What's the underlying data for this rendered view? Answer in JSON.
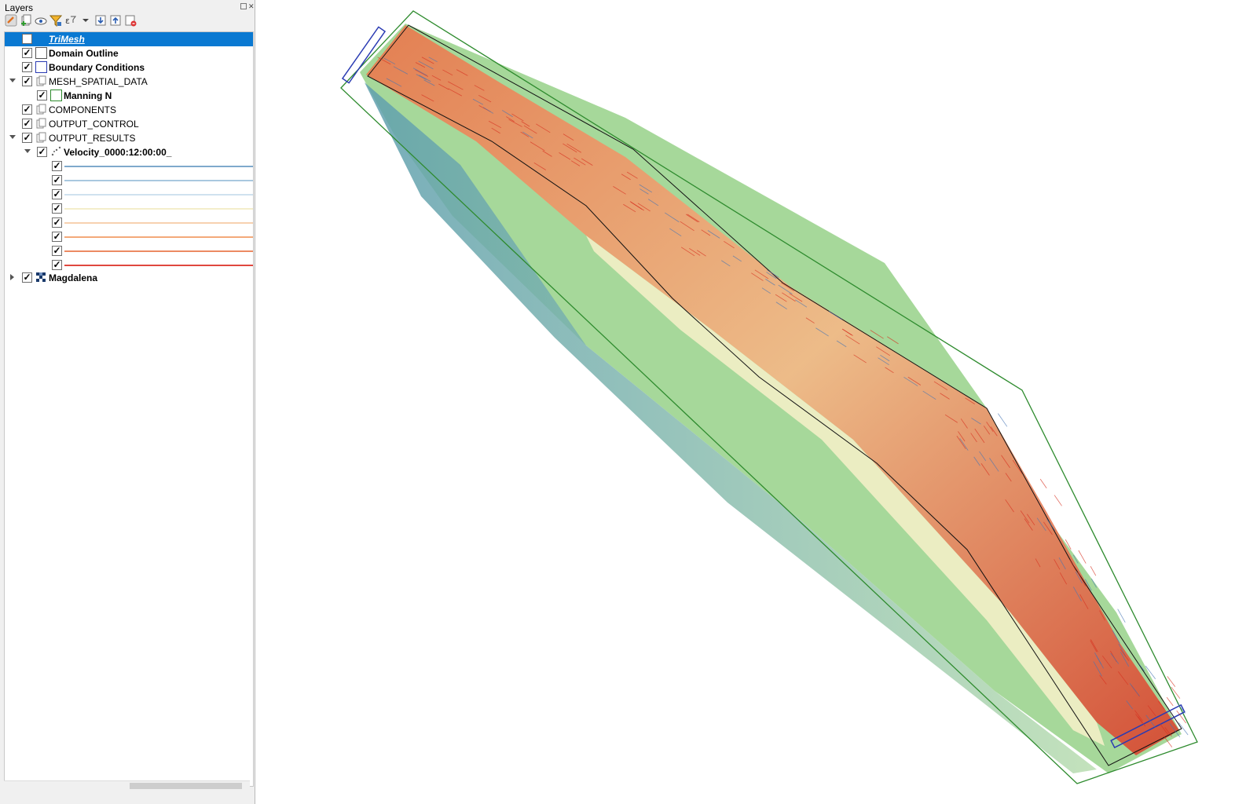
{
  "panel": {
    "title": "Layers",
    "toolbar": [
      "style-manager-icon",
      "add-group-icon",
      "visibility-icon",
      "filter-legend-icon",
      "filter-expression-icon",
      "expand-all-icon",
      "collapse-all-icon",
      "remove-layer-icon"
    ]
  },
  "layers": [
    {
      "name": "TriMesh",
      "checked": false,
      "selected": true
    },
    {
      "name": "Domain Outline",
      "checked": true
    },
    {
      "name": "Boundary Conditions",
      "checked": true
    },
    {
      "name": "MESH_SPATIAL_DATA",
      "checked": true,
      "expanded": true
    },
    {
      "name": "Manning N",
      "checked": true
    },
    {
      "name": "COMPONENTS",
      "checked": true
    },
    {
      "name": "OUTPUT_CONTROL",
      "checked": true
    },
    {
      "name": "OUTPUT_RESULTS",
      "checked": true,
      "expanded": true
    },
    {
      "name": "Velocity_0000:12:00:00_",
      "checked": true,
      "expanded": true
    },
    {
      "name": "Magdalena",
      "checked": true,
      "expanded": false
    }
  ],
  "legend_colors": [
    "#7fa9cc",
    "#a9c8df",
    "#d0e2ef",
    "#f4eecb",
    "#f7d1b0",
    "#f3a97a",
    "#ec8a63",
    "#e0483f"
  ],
  "colors": {
    "selection": "#0a79d2",
    "domain_outline": "#2e8b2e",
    "boundary_conditions": "#2a3bb3",
    "velocity_high": "#d7301f",
    "velocity_low": "#4575b4"
  }
}
